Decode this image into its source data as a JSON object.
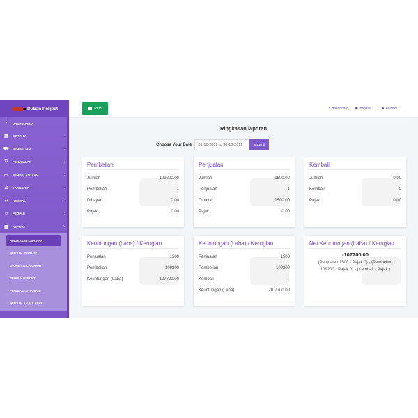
{
  "brand": {
    "title": "Duban Project"
  },
  "sidebar": {
    "items": [
      {
        "label": "DASHBOARD",
        "icon": "dashboard-icon",
        "glyph": "◔",
        "chevron": ""
      },
      {
        "label": "PRODUK",
        "icon": "barcode-icon",
        "glyph": "▤",
        "chevron": "›"
      },
      {
        "label": "PEMBELIAN",
        "icon": "truck-icon",
        "glyph": "⛟",
        "chevron": "›"
      },
      {
        "label": "PENJUALAN",
        "icon": "cart-icon",
        "glyph": "⛉",
        "chevron": "›"
      },
      {
        "label": "PEMBELANJAAN",
        "icon": "wallet-icon",
        "glyph": "▭",
        "chevron": "›"
      },
      {
        "label": "TRANSFER",
        "icon": "transfer-icon",
        "glyph": "⇄",
        "chevron": "›"
      },
      {
        "label": "KEMBALI",
        "icon": "return-icon",
        "glyph": "↩",
        "chevron": "›"
      },
      {
        "label": "PEOPLE",
        "icon": "user-icon",
        "glyph": "☺",
        "chevron": "›"
      },
      {
        "label": "REPORT",
        "icon": "report-icon",
        "glyph": "▦",
        "chevron": "˅"
      }
    ],
    "report_sub": [
      "RINGKASAN LAPORAN",
      "PENJUAL TERBAIK",
      "STORE STOCK CHART",
      "PRODUK REPORT",
      "PENJUALAN HARIAN",
      "PENJUALAN BULANAN"
    ]
  },
  "topbar": {
    "pos_label": "POS",
    "dashboard_label": "dashboard",
    "bahasa_label": "bahasa",
    "admin_label": "ADMIN"
  },
  "page": {
    "title": "Ringkasan laporan",
    "date_label": "Choose Your Date",
    "date_value": "01-10-2019 to 30-10-2019",
    "submit_label": "submit"
  },
  "cards": {
    "pembelian": {
      "title": "Pembelian",
      "rows": [
        {
          "label": "Jumlah",
          "value": "109200.00"
        },
        {
          "label": "Pembelian",
          "value": "1"
        },
        {
          "label": "Dibayar",
          "value": "0.00"
        },
        {
          "label": "Pajak",
          "value": "0.00"
        }
      ]
    },
    "penjualan": {
      "title": "Penjualan",
      "rows": [
        {
          "label": "Jumlah",
          "value": "1500.00"
        },
        {
          "label": "Penjualan",
          "value": "1"
        },
        {
          "label": "Dibayar",
          "value": "1500.00"
        },
        {
          "label": "Pajak",
          "value": "0.00"
        }
      ]
    },
    "kembali": {
      "title": "Kembali",
      "rows": [
        {
          "label": "Jumlah",
          "value": "0.00"
        },
        {
          "label": "Kembali",
          "value": "0"
        },
        {
          "label": "Pajak",
          "value": "0.00"
        }
      ]
    },
    "keuntungan1": {
      "title": "Keuntungan (Laba) / Kerugian",
      "rows": [
        {
          "label": "Penjualan",
          "value": "1500"
        },
        {
          "label": "Pembelian",
          "value": "- 109200"
        },
        {
          "label": "Keuntungan (Laba)",
          "value": "-107700.00"
        }
      ]
    },
    "keuntungan2": {
      "title": "Keuntungan (Laba) / Kerugian",
      "rows": [
        {
          "label": "Penjualan",
          "value": "1500"
        },
        {
          "label": "Pembelian",
          "value": "- 109200"
        },
        {
          "label": "Kembali",
          "value": "-"
        },
        {
          "label": "Keuntungan (Laba)",
          "value": "-107700.00"
        }
      ]
    },
    "net": {
      "title": "Net Keuntungan (Laba) / Kerugian",
      "value": "-107700.00",
      "description": "(Penjualan 1500 - Pajak 0) - (Pembelian 109200 - Pajak 0) - (Kembali - Pajak )"
    }
  },
  "colors": {
    "sidebar": "#7d55c7",
    "accent": "#7448c8",
    "pos_button": "#1aa05a"
  }
}
